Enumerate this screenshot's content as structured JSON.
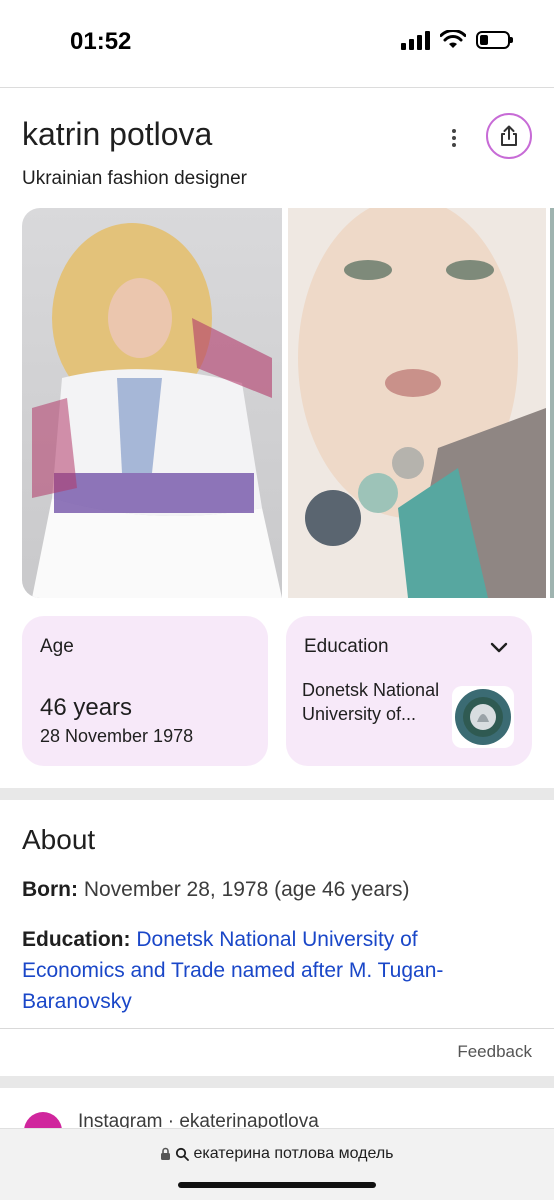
{
  "status_bar": {
    "time": "01:52",
    "battery_level": 0.3
  },
  "header": {
    "title": "katrin potlova",
    "subtitle": "Ukrainian fashion designer"
  },
  "icons": {
    "more": "more-vert-icon",
    "share": "share-icon",
    "chevron": "chevron-down-icon",
    "lock": "lock-icon",
    "search": "search-icon",
    "instagram": "instagram-icon"
  },
  "colors": {
    "accent": "#c76bd6",
    "card_bg": "#f7e9f9",
    "link": "#1a47c8",
    "instagram": "#d0269d"
  },
  "age_card": {
    "label": "Age",
    "value": "46 years",
    "date": "28 November 1978"
  },
  "education_card": {
    "label": "Education",
    "value": "Donetsk National University of..."
  },
  "about": {
    "title": "About",
    "born_label": "Born:",
    "born_value": " November 28, 1978 (age 46 years)",
    "education_label": "Education:",
    "education_value": "Donetsk National University of Economics and Trade named after M. Tugan-Baranovsky"
  },
  "feedback": "Feedback",
  "result": {
    "source": "Instagram · ekaterinapotlova"
  },
  "address_bar": {
    "query": "екатерина потлова модель"
  }
}
